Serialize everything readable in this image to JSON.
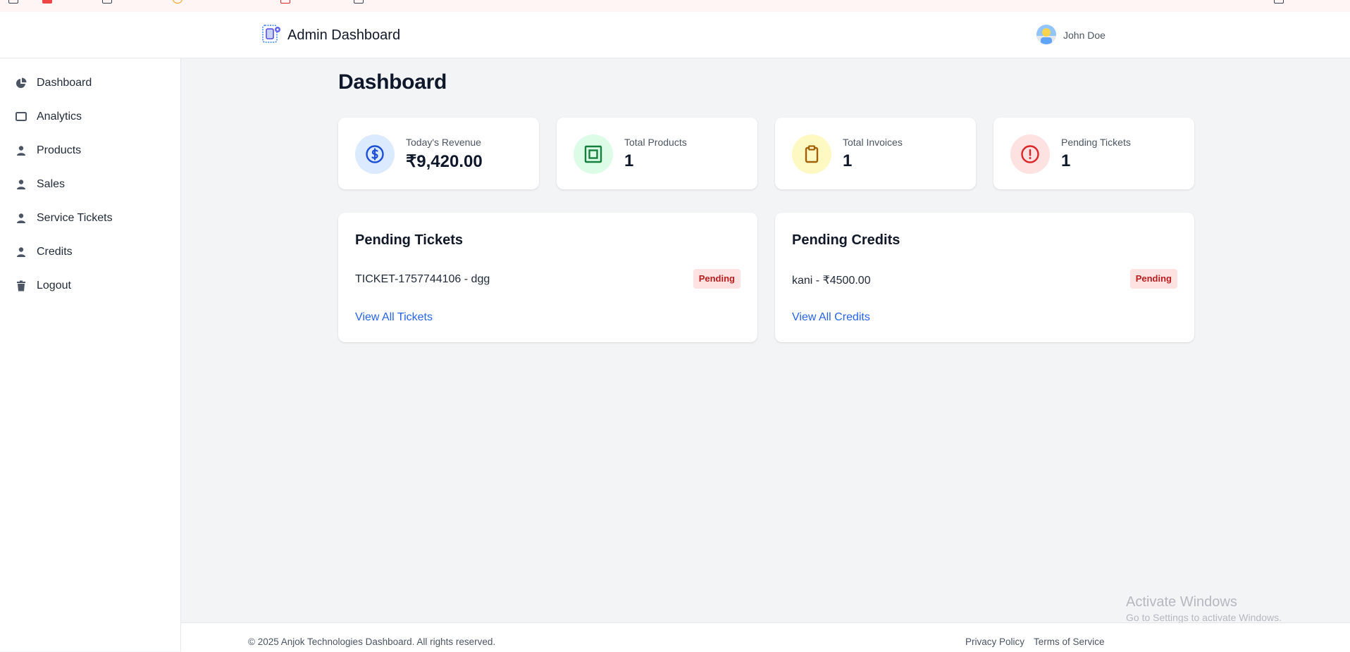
{
  "header": {
    "app_title": "Admin Dashboard",
    "user_name": "John Doe"
  },
  "sidebar": {
    "items": [
      {
        "label": "Dashboard",
        "icon": "pie-chart-icon"
      },
      {
        "label": "Analytics",
        "icon": "monitor-icon"
      },
      {
        "label": "Products",
        "icon": "user-icon"
      },
      {
        "label": "Sales",
        "icon": "user-icon"
      },
      {
        "label": "Service Tickets",
        "icon": "user-icon"
      },
      {
        "label": "Credits",
        "icon": "user-icon"
      },
      {
        "label": "Logout",
        "icon": "trash-icon"
      }
    ]
  },
  "main": {
    "title": "Dashboard",
    "stats": [
      {
        "label": "Today's Revenue",
        "value": "₹9,420.00",
        "icon": "dollar-circle-icon",
        "color": "#1d4ed8",
        "bg": "#dbeafe"
      },
      {
        "label": "Total Products",
        "value": "1",
        "icon": "box-icon",
        "color": "#15803d",
        "bg": "#dcfce7"
      },
      {
        "label": "Total Invoices",
        "value": "1",
        "icon": "clipboard-icon",
        "color": "#a16207",
        "bg": "#fef9c3"
      },
      {
        "label": "Pending Tickets",
        "value": "1",
        "icon": "alert-circle-icon",
        "color": "#dc2626",
        "bg": "#fee2e2"
      }
    ],
    "panels": {
      "tickets": {
        "title": "Pending Tickets",
        "item": "TICKET-1757744106 - dgg",
        "status": "Pending",
        "link": "View All Tickets"
      },
      "credits": {
        "title": "Pending Credits",
        "item": "kani - ₹4500.00",
        "status": "Pending",
        "link": "View All Credits"
      }
    }
  },
  "watermark": {
    "line1": "Activate Windows",
    "line2": "Go to Settings to activate Windows."
  },
  "footer": {
    "copyright": "© 2025 Anjok Technologies Dashboard. All rights reserved.",
    "privacy": "Privacy Policy",
    "terms": "Terms of Service"
  },
  "colors": {
    "accent": "#2563eb",
    "badge_bg": "#fee2e2",
    "badge_text": "#b91c1c",
    "background": "#f3f4f6"
  }
}
